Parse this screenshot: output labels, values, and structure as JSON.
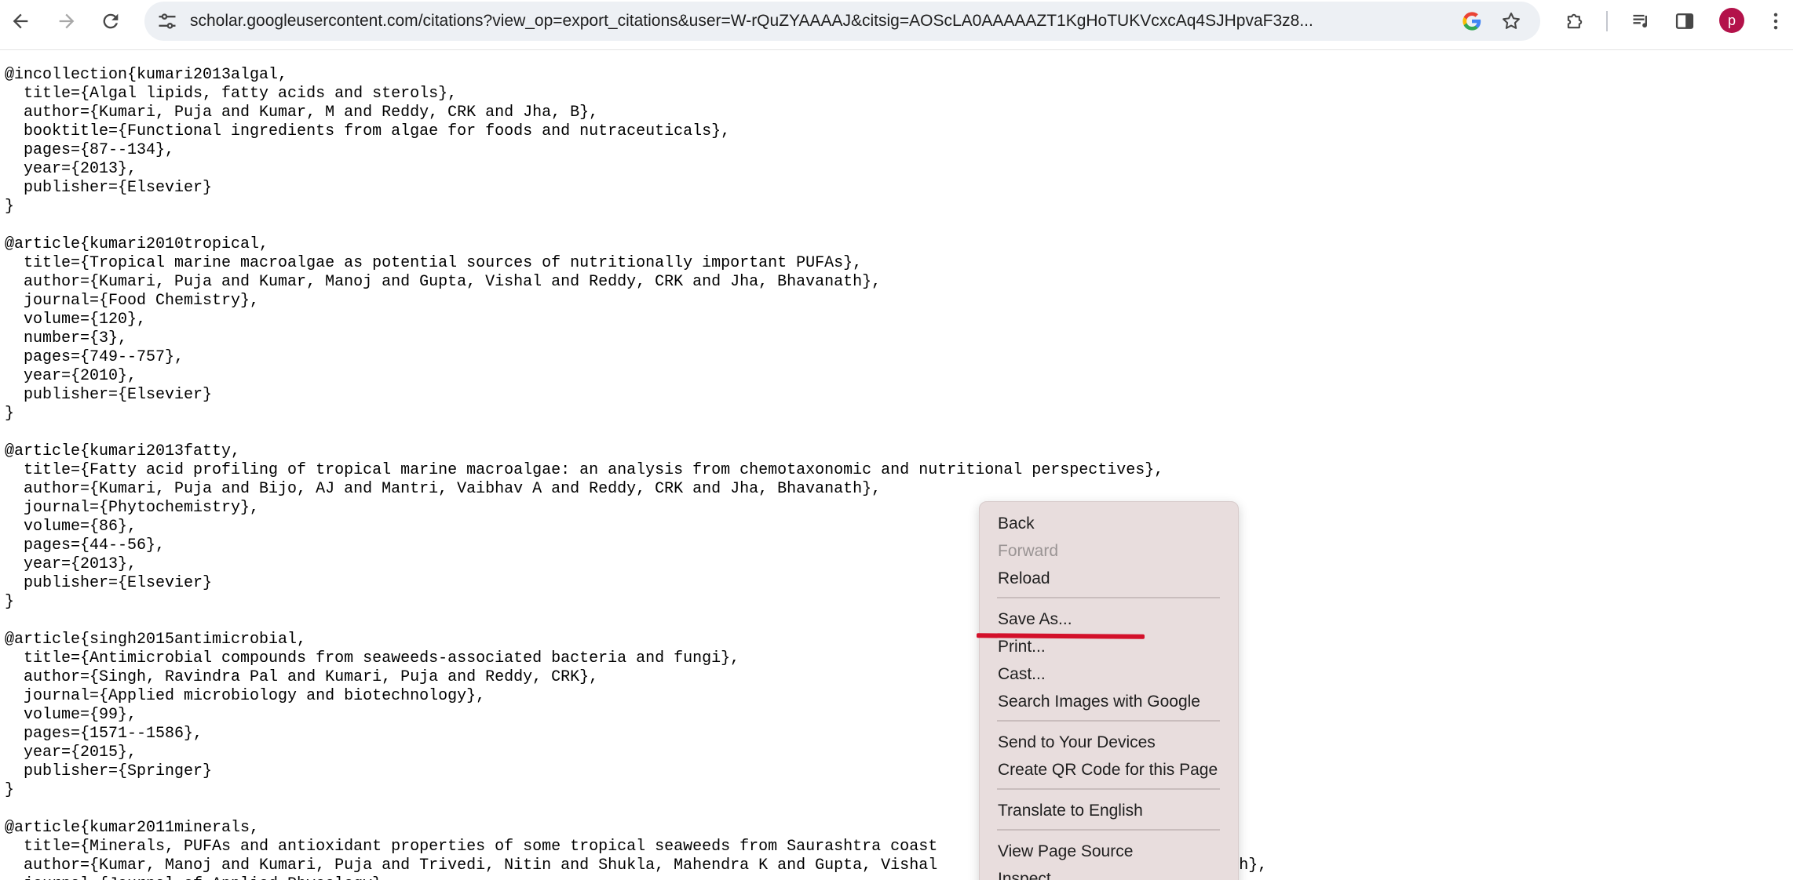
{
  "browser": {
    "url_host": "scholar.googleusercontent.com",
    "url_rest": "/citations?view_op=export_citations&user=W-rQuZYAAAAJ&citsig=AOScLA0AAAAAZT1KgHoTUKVcxcAq4SJHpvaF3z8...",
    "avatar_letter": "p",
    "avatar_color": "#b3124a",
    "icons": {
      "back": "arrow-left-icon",
      "forward": "arrow-right-icon",
      "reload": "reload-icon",
      "site_info": "tune-icon",
      "google_lens": "google-g-icon",
      "bookmark": "star-icon",
      "extensions": "puzzle-icon",
      "media": "media-controls-icon",
      "side_panel": "side-panel-icon",
      "menu": "kebab-menu-icon"
    }
  },
  "page": {
    "bibtex": "@incollection{kumari2013algal,\n  title={Algal lipids, fatty acids and sterols},\n  author={Kumari, Puja and Kumar, M and Reddy, CRK and Jha, B},\n  booktitle={Functional ingredients from algae for foods and nutraceuticals},\n  pages={87--134},\n  year={2013},\n  publisher={Elsevier}\n}\n\n@article{kumari2010tropical,\n  title={Tropical marine macroalgae as potential sources of nutritionally important PUFAs},\n  author={Kumari, Puja and Kumar, Manoj and Gupta, Vishal and Reddy, CRK and Jha, Bhavanath},\n  journal={Food Chemistry},\n  volume={120},\n  number={3},\n  pages={749--757},\n  year={2010},\n  publisher={Elsevier}\n}\n\n@article{kumari2013fatty,\n  title={Fatty acid profiling of tropical marine macroalgae: an analysis from chemotaxonomic and nutritional perspectives},\n  author={Kumari, Puja and Bijo, AJ and Mantri, Vaibhav A and Reddy, CRK and Jha, Bhavanath},\n  journal={Phytochemistry},\n  volume={86},\n  pages={44--56},\n  year={2013},\n  publisher={Elsevier}\n}\n\n@article{singh2015antimicrobial,\n  title={Antimicrobial compounds from seaweeds-associated bacteria and fungi},\n  author={Singh, Ravindra Pal and Kumari, Puja and Reddy, CRK},\n  journal={Applied microbiology and biotechnology},\n  volume={99},\n  pages={1571--1586},\n  year={2015},\n  publisher={Springer}\n}\n\n@article{kumar2011minerals,\n  title={Minerals, PUFAs and antioxidant properties of some tropical seaweeds from Saurashtra coast\n  author={Kumar, Manoj and Kumari, Puja and Trivedi, Nitin and Shukla, Mahendra K and Gupta, Vishal                          avanath},\n  journal={Journal of Applied Phycology}"
  },
  "context_menu": {
    "items": [
      {
        "label": "Back",
        "enabled": true
      },
      {
        "label": "Forward",
        "enabled": false
      },
      {
        "label": "Reload",
        "enabled": true
      },
      {
        "label": "Save As...",
        "enabled": true
      },
      {
        "label": "Print...",
        "enabled": true
      },
      {
        "label": "Cast...",
        "enabled": true
      },
      {
        "label": "Search Images with Google",
        "enabled": true
      },
      {
        "label": "Send to Your Devices",
        "enabled": true
      },
      {
        "label": "Create QR Code for this Page",
        "enabled": true
      },
      {
        "label": "Translate to English",
        "enabled": true
      },
      {
        "label": "View Page Source",
        "enabled": true
      },
      {
        "label": "Inspect",
        "enabled": true
      }
    ],
    "annotation_color": "#d3102a"
  }
}
